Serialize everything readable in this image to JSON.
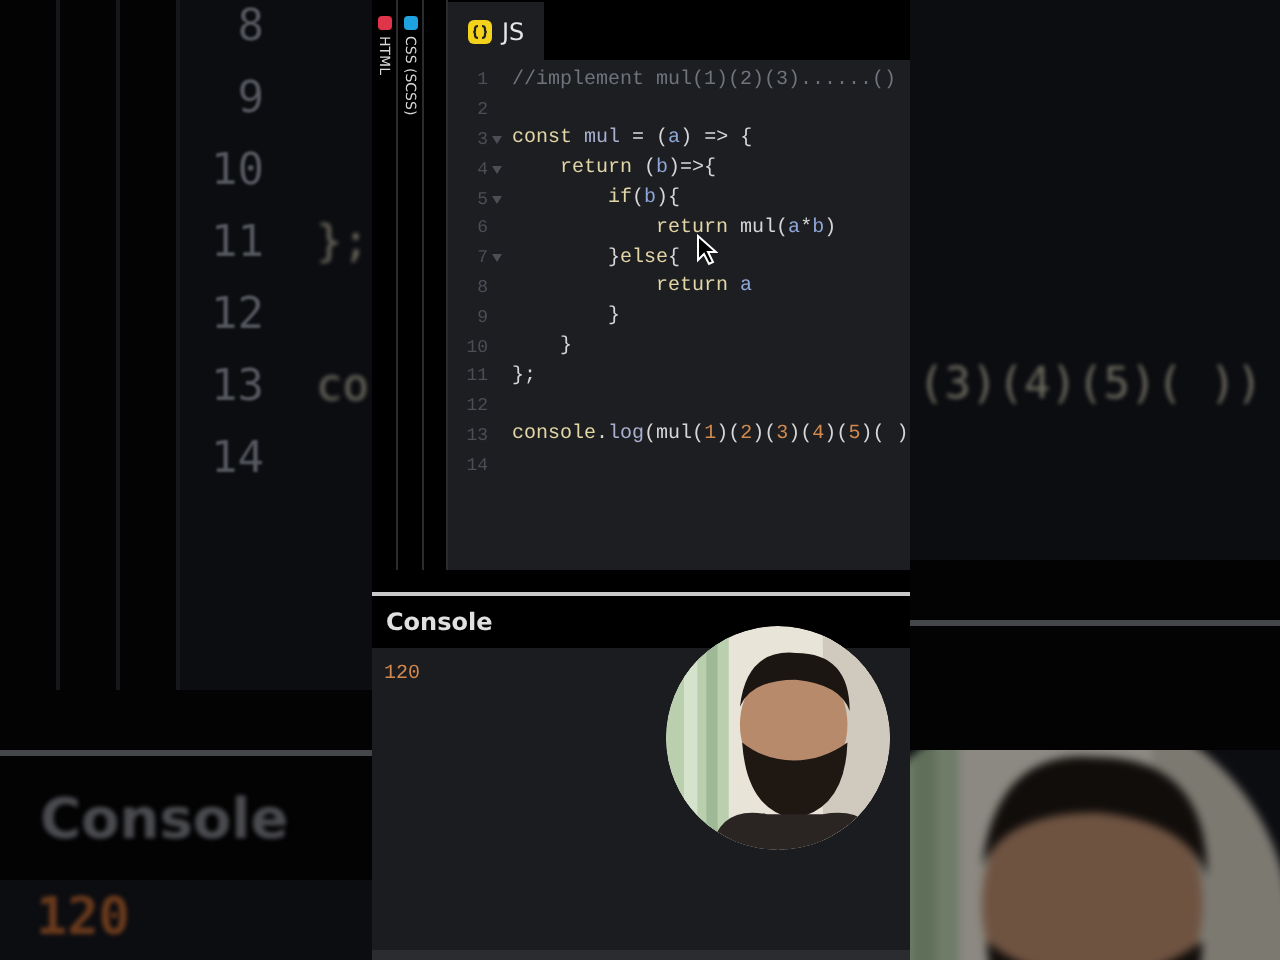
{
  "backdrop": {
    "left": {
      "lines": [
        {
          "number": "8"
        },
        {
          "number": "9"
        },
        {
          "number": "10"
        },
        {
          "number": "11",
          "code": "};"
        },
        {
          "number": "12"
        },
        {
          "number": "13",
          "code": "co"
        },
        {
          "number": "14"
        }
      ],
      "console_title": "Console",
      "console_output": "120"
    },
    "right": {
      "code": "(3)(4)(5)( ))"
    }
  },
  "side_tabs": [
    {
      "label": "HTML",
      "color": "#e0344a"
    },
    {
      "label": "CSS (SCSS)",
      "color": "#1fa3e0"
    }
  ],
  "editor": {
    "tab": {
      "label": "JS",
      "selected": true
    },
    "lines": [
      {
        "number": "1",
        "fold": false,
        "tokens": [
          {
            "kind": "comment",
            "text": "//implement mul(1)(2)(3)......()"
          }
        ]
      },
      {
        "number": "2",
        "fold": false
      },
      {
        "number": "3",
        "fold": true,
        "tokens": [
          {
            "kind": "keyword",
            "text": "const"
          },
          {
            "kind": "name",
            "text": " mul"
          },
          {
            "kind": "plain",
            "text": " = ("
          },
          {
            "kind": "param",
            "text": "a"
          },
          {
            "kind": "plain",
            "text": ") => {"
          }
        ]
      },
      {
        "number": "4",
        "fold": true,
        "tokens": [
          {
            "kind": "keyword",
            "text": "    return"
          },
          {
            "kind": "plain",
            "text": " ("
          },
          {
            "kind": "param",
            "text": "b"
          },
          {
            "kind": "plain",
            "text": ")=>{"
          }
        ]
      },
      {
        "number": "5",
        "fold": true,
        "tokens": [
          {
            "kind": "keyword",
            "text": "        if"
          },
          {
            "kind": "plain",
            "text": "("
          },
          {
            "kind": "param",
            "text": "b"
          },
          {
            "kind": "plain",
            "text": "){"
          }
        ]
      },
      {
        "number": "6",
        "fold": false,
        "tokens": [
          {
            "kind": "keyword",
            "text": "            return"
          },
          {
            "kind": "plain",
            "text": " mul("
          },
          {
            "kind": "param",
            "text": "a"
          },
          {
            "kind": "plain",
            "text": "*"
          },
          {
            "kind": "param",
            "text": "b"
          },
          {
            "kind": "plain",
            "text": ")"
          }
        ]
      },
      {
        "number": "7",
        "fold": true,
        "tokens": [
          {
            "kind": "plain",
            "text": "        }"
          },
          {
            "kind": "keyword",
            "text": "else"
          },
          {
            "kind": "plain",
            "text": "{"
          }
        ]
      },
      {
        "number": "8",
        "fold": false,
        "tokens": [
          {
            "kind": "keyword",
            "text": "            return"
          },
          {
            "kind": "param",
            "text": " a"
          }
        ]
      },
      {
        "number": "9",
        "fold": false,
        "tokens": [
          {
            "kind": "plain",
            "text": "        }"
          }
        ]
      },
      {
        "number": "10",
        "fold": false,
        "tokens": [
          {
            "kind": "plain",
            "text": "    }"
          }
        ]
      },
      {
        "number": "11",
        "fold": false,
        "tokens": [
          {
            "kind": "plain",
            "text": "};"
          }
        ]
      },
      {
        "number": "12",
        "fold": false
      },
      {
        "number": "13",
        "fold": false,
        "tokens": [
          {
            "kind": "keyword",
            "text": "console"
          },
          {
            "kind": "plain",
            "text": "."
          },
          {
            "kind": "name",
            "text": "log"
          },
          {
            "kind": "plain",
            "text": "(mul("
          },
          {
            "kind": "number",
            "text": "1"
          },
          {
            "kind": "plain",
            "text": ")("
          },
          {
            "kind": "number",
            "text": "2"
          },
          {
            "kind": "plain",
            "text": ")("
          },
          {
            "kind": "number",
            "text": "3"
          },
          {
            "kind": "plain",
            "text": ")("
          },
          {
            "kind": "number",
            "text": "4"
          },
          {
            "kind": "plain",
            "text": ")("
          },
          {
            "kind": "number",
            "text": "5"
          },
          {
            "kind": "plain",
            "text": ")( )"
          }
        ]
      },
      {
        "number": "14",
        "fold": false
      }
    ]
  },
  "console": {
    "title": "Console",
    "output": "120"
  }
}
